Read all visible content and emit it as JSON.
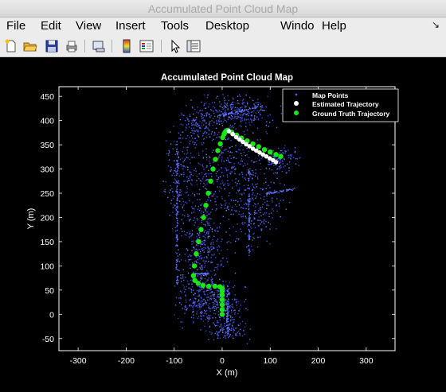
{
  "window": {
    "title": "Accumulated Point Cloud Map"
  },
  "menu": {
    "items": [
      "File",
      "Edit",
      "View",
      "Insert",
      "Tools",
      "Desktop",
      "Windo",
      "Help"
    ],
    "dock_icon": "dock-arrow-icon"
  },
  "toolbar": {
    "icons": [
      "new-figure-icon",
      "open-file-icon",
      "save-icon",
      "print-icon",
      "link-plot-icon",
      "colorbar-icon",
      "legend-icon",
      "edit-plot-icon",
      "property-inspector-icon"
    ]
  },
  "colors": {
    "background": "#000000",
    "map_points": "#4a5ee8",
    "estimated": "#ffffff",
    "ground_truth": "#19e619"
  },
  "chart_data": {
    "type": "scatter",
    "title": "Accumulated Point Cloud Map",
    "xlabel": "X (m)",
    "ylabel": "Y (m)",
    "xlim": [
      -340,
      360
    ],
    "ylim": [
      -75,
      470
    ],
    "xticks": [
      -300,
      -200,
      -100,
      0,
      100,
      200,
      300
    ],
    "yticks": [
      -50,
      0,
      50,
      100,
      150,
      200,
      250,
      300,
      350,
      400,
      450
    ],
    "legend_position": "top-right",
    "grid": false,
    "series": [
      {
        "name": "Map Points",
        "marker": "dot"
      },
      {
        "name": "Estimated Trajectory",
        "marker": "circle",
        "x": [
          14,
          22,
          29,
          36,
          43,
          50,
          57,
          64,
          71,
          78,
          85,
          92,
          99,
          106,
          112
        ],
        "y": [
          378,
          372,
          366,
          361,
          356,
          351,
          347,
          342,
          338,
          334,
          330,
          326,
          322,
          318,
          314
        ]
      },
      {
        "name": "Ground Truth Trajectory",
        "marker": "circle",
        "x": [
          0,
          0,
          0,
          0,
          0,
          0,
          0,
          -5,
          -15,
          -28,
          -40,
          -50,
          -57,
          -60,
          -58,
          -54,
          -49,
          -44,
          -39,
          -34,
          -29,
          -24,
          -19,
          -14,
          -9,
          -4,
          1,
          4,
          6,
          8,
          12,
          20,
          30,
          40,
          52,
          64,
          76,
          88,
          100,
          112,
          122
        ],
        "y": [
          0,
          10,
          20,
          30,
          40,
          48,
          54,
          57,
          58,
          58,
          60,
          64,
          70,
          80,
          100,
          125,
          150,
          175,
          200,
          225,
          250,
          275,
          300,
          320,
          338,
          352,
          365,
          372,
          376,
          378,
          380,
          376,
          370,
          364,
          358,
          352,
          346,
          340,
          335,
          330,
          326
        ]
      }
    ]
  }
}
